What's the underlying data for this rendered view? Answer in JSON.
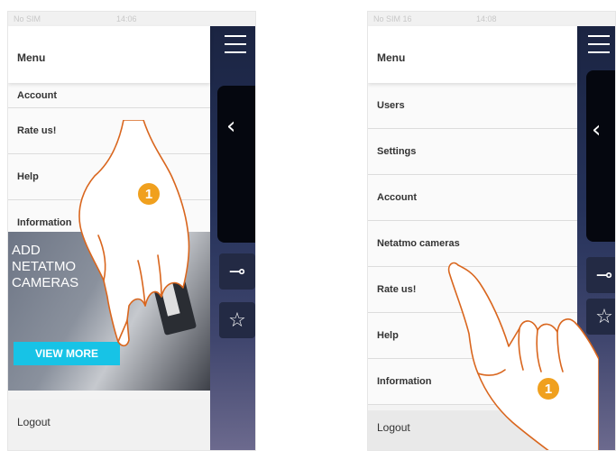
{
  "left_screen": {
    "status": {
      "carrier": "No SIM",
      "time": "14:06"
    },
    "menu_title": "Menu",
    "items": [
      "Account",
      "Rate us!",
      "Help",
      "Information"
    ],
    "promo": {
      "title": "ADD\nNETATMO\nCAMERAS",
      "button": "VIEW MORE"
    },
    "logout": "Logout",
    "step": "1"
  },
  "right_screen": {
    "status": {
      "carrier": "No SIM 16",
      "time": "14:08"
    },
    "menu_title": "Menu",
    "items": [
      "Users",
      "Settings",
      "Account",
      "Netatmo cameras",
      "Rate us!",
      "Help",
      "Information"
    ],
    "logout": "Logout",
    "step": "1"
  },
  "colors": {
    "accent_button": "#17c3e6",
    "step_badge": "#f0a01e",
    "hand_outline": "#d9661e",
    "app_panel": "#1a2340"
  },
  "icons": {
    "menu": "hamburger-icon",
    "back": "chevron-left-icon",
    "key": "key-icon",
    "favorite": "star-icon",
    "battery": "battery-icon"
  }
}
